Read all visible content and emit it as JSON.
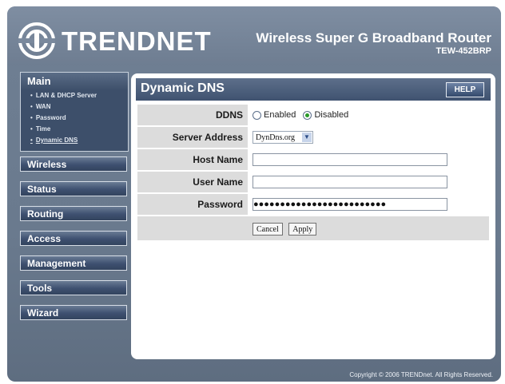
{
  "header": {
    "logo_text": "TRENDNET",
    "product_name": "Wireless Super G Broadband Router",
    "model": "TEW-452BRP"
  },
  "sidebar": {
    "main": {
      "label": "Main",
      "items": [
        "LAN & DHCP Server",
        "WAN",
        "Password",
        "Time",
        "Dynamic DNS"
      ],
      "active_index": 4
    },
    "menu": [
      "Wireless",
      "Status",
      "Routing",
      "Access",
      "Management",
      "Tools",
      "Wizard"
    ]
  },
  "panel": {
    "title": "Dynamic DNS",
    "help_label": "HELP",
    "fields": {
      "ddns_label": "DDNS",
      "enabled_label": "Enabled",
      "disabled_label": "Disabled",
      "selected": "Disabled",
      "server_label": "Server Address",
      "server_value": "DynDns.org",
      "host_label": "Host Name",
      "host_value": "",
      "user_label": "User Name",
      "user_value": "",
      "password_label": "Password",
      "password_value": "●●●●●●●●●●●●●●●●●●●●●●●●●"
    },
    "buttons": {
      "cancel": "Cancel",
      "apply": "Apply"
    }
  },
  "footer": "Copyright © 2006 TRENDnet. All Rights Reserved.",
  "colors": {
    "header": "#7a899d",
    "panel_header": "#4b5e7c",
    "menu": "#3e5070",
    "label_bg": "#dcdcdc"
  }
}
